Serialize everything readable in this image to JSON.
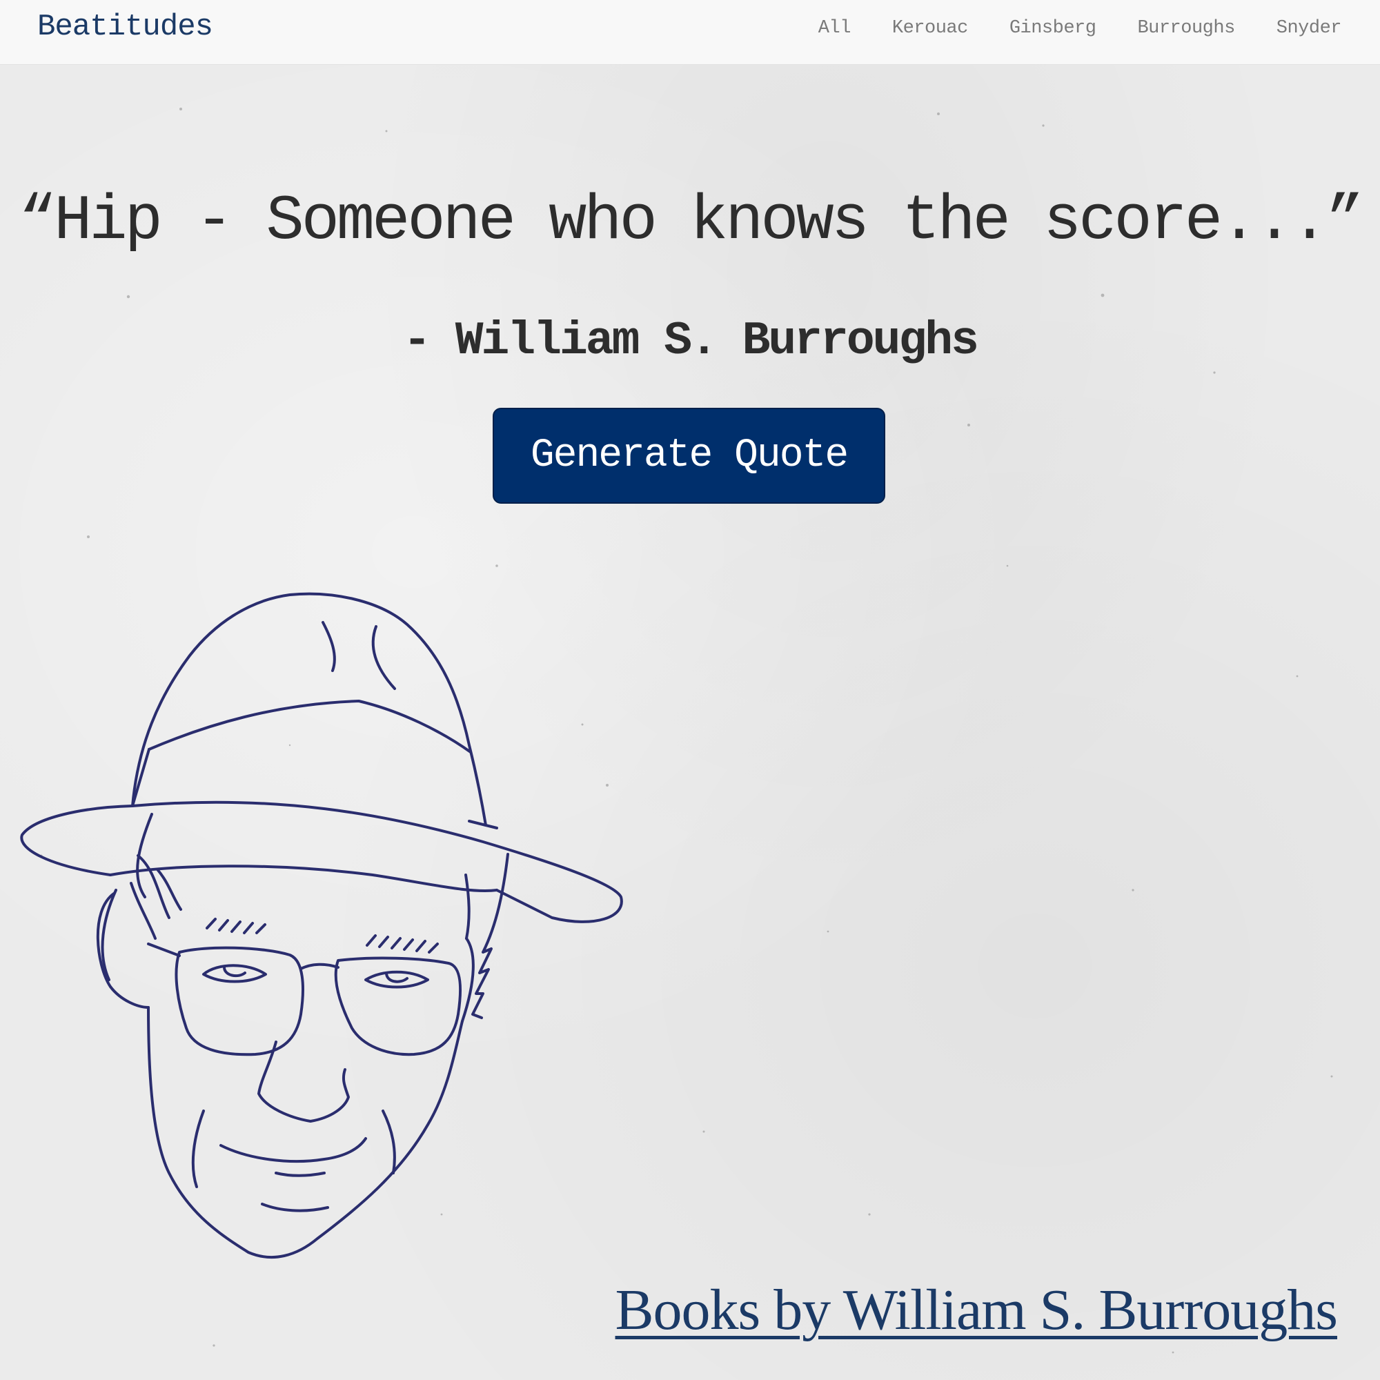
{
  "navbar": {
    "brand": "Beatitudes",
    "links": [
      "All",
      "Kerouac",
      "Ginsberg",
      "Burroughs",
      "Snyder"
    ]
  },
  "quote": {
    "text": "“Hip - Someone who knows the score...”",
    "author": "- William S. Burroughs"
  },
  "generate_button": {
    "label": "Generate Quote"
  },
  "books_link": {
    "label": "Books by William S. Burroughs"
  },
  "colors": {
    "brand_blue": "#1b3a66",
    "button_blue": "#002f6c",
    "line_art": "#2a2d6e",
    "paper": "#ebebeb",
    "text": "#2d2d2d"
  },
  "illustration": {
    "subject": "portrait-line-art"
  }
}
